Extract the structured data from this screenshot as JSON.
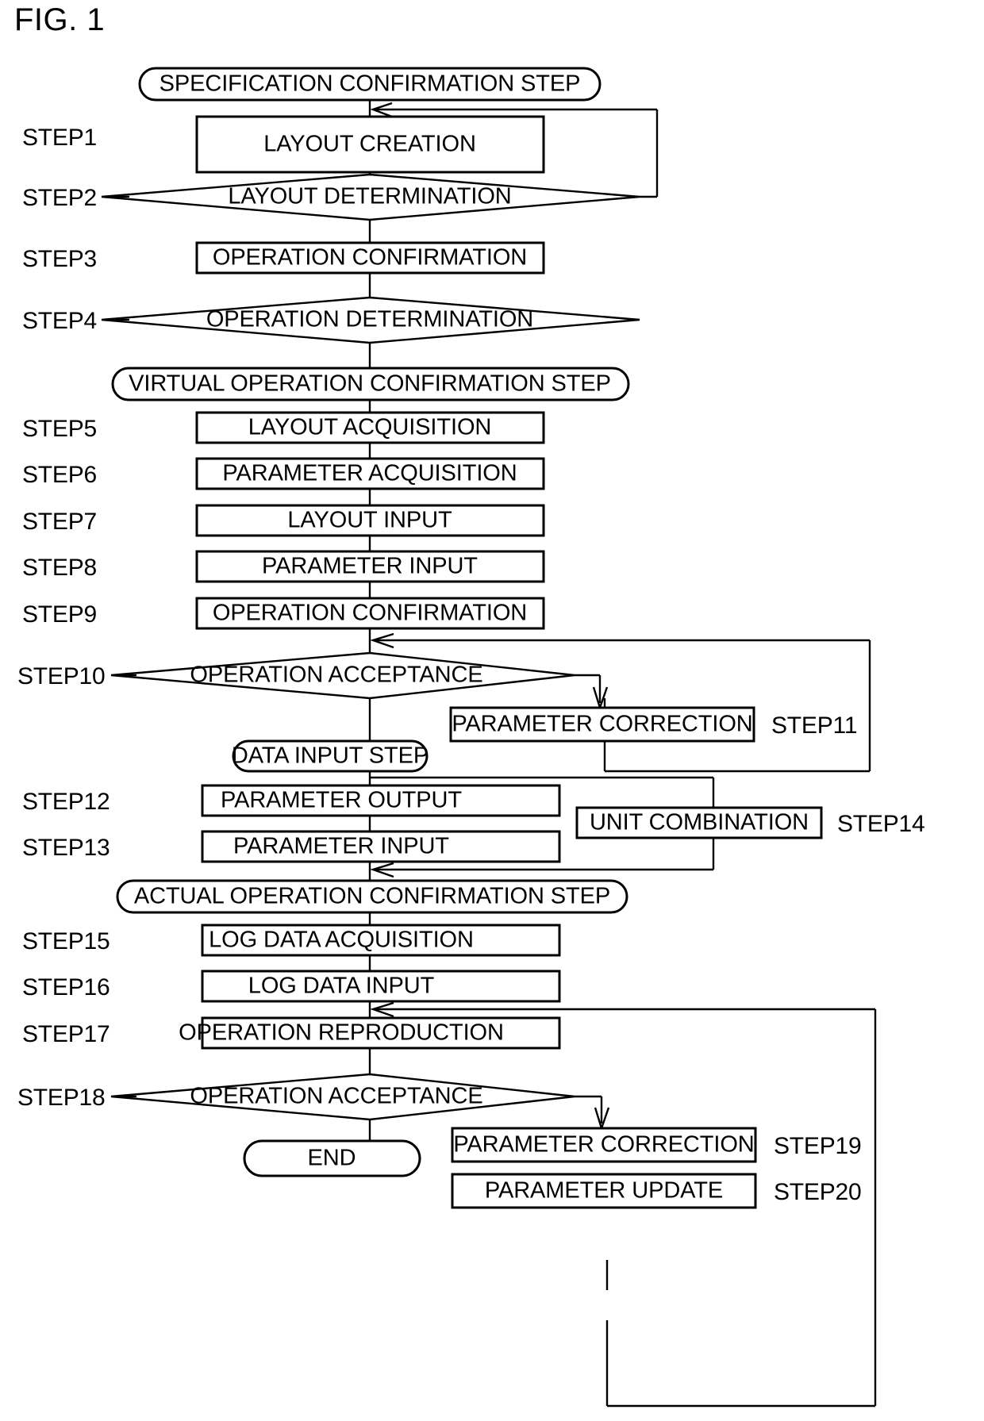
{
  "figure": {
    "caption": "FIG. 1"
  },
  "step_labels": [
    {
      "id": "step1",
      "text": "STEP1"
    },
    {
      "id": "step2",
      "text": "STEP2"
    },
    {
      "id": "step3",
      "text": "STEP3"
    },
    {
      "id": "step4",
      "text": "STEP4"
    },
    {
      "id": "step5",
      "text": "STEP5"
    },
    {
      "id": "step6",
      "text": "STEP6"
    },
    {
      "id": "step7",
      "text": "STEP7"
    },
    {
      "id": "step8",
      "text": "STEP8"
    },
    {
      "id": "step9",
      "text": "STEP9"
    },
    {
      "id": "step10",
      "text": "STEP10"
    },
    {
      "id": "step11",
      "text": "STEP11"
    },
    {
      "id": "step12",
      "text": "STEP12"
    },
    {
      "id": "step13",
      "text": "STEP13"
    },
    {
      "id": "step14",
      "text": "STEP14"
    },
    {
      "id": "step15",
      "text": "STEP15"
    },
    {
      "id": "step16",
      "text": "STEP16"
    },
    {
      "id": "step17",
      "text": "STEP17"
    },
    {
      "id": "step18",
      "text": "STEP18"
    },
    {
      "id": "step19",
      "text": "STEP19"
    },
    {
      "id": "step20",
      "text": "STEP20"
    }
  ],
  "nodes": {
    "spec_confirmation_step": {
      "text": "SPECIFICATION CONFIRMATION STEP",
      "shape": "stadium"
    },
    "layout_creation": {
      "text": "LAYOUT CREATION",
      "shape": "rect"
    },
    "layout_determination": {
      "text": "LAYOUT DETERMINATION",
      "shape": "diamond"
    },
    "operation_confirmation_1": {
      "text": "OPERATION CONFIRMATION",
      "shape": "rect"
    },
    "operation_determination": {
      "text": "OPERATION DETERMINATION",
      "shape": "diamond"
    },
    "virtual_operation_confirmation_step": {
      "text": "VIRTUAL OPERATION CONFIRMATION STEP",
      "shape": "stadium"
    },
    "layout_acquisition": {
      "text": "LAYOUT ACQUISITION",
      "shape": "rect"
    },
    "parameter_acquisition": {
      "text": "PARAMETER ACQUISITION",
      "shape": "rect"
    },
    "layout_input": {
      "text": "LAYOUT INPUT",
      "shape": "rect"
    },
    "parameter_input_1": {
      "text": "PARAMETER INPUT",
      "shape": "rect"
    },
    "operation_confirmation_2": {
      "text": "OPERATION CONFIRMATION",
      "shape": "rect"
    },
    "operation_acceptance_1": {
      "text": "OPERATION ACCEPTANCE",
      "shape": "diamond"
    },
    "parameter_correction_1": {
      "text": "PARAMETER CORRECTION",
      "shape": "rect"
    },
    "data_input_step": {
      "text": "DATA INPUT STEP",
      "shape": "stadium"
    },
    "parameter_output": {
      "text": "PARAMETER OUTPUT",
      "shape": "rect"
    },
    "unit_combination": {
      "text": "UNIT COMBINATION",
      "shape": "rect"
    },
    "parameter_input_2": {
      "text": "PARAMETER INPUT",
      "shape": "rect"
    },
    "actual_operation_confirmation_step": {
      "text": "ACTUAL OPERATION CONFIRMATION STEP",
      "shape": "stadium"
    },
    "log_data_acquisition": {
      "text": "LOG DATA ACQUISITION",
      "shape": "rect"
    },
    "log_data_input": {
      "text": "LOG DATA INPUT",
      "shape": "rect"
    },
    "operation_reproduction": {
      "text": "OPERATION REPRODUCTION",
      "shape": "rect"
    },
    "operation_acceptance_2": {
      "text": "OPERATION ACCEPTANCE",
      "shape": "diamond"
    },
    "end": {
      "text": "END",
      "shape": "stadium"
    },
    "parameter_correction_2": {
      "text": "PARAMETER CORRECTION",
      "shape": "rect"
    },
    "parameter_update": {
      "text": "PARAMETER UPDATE",
      "shape": "rect"
    }
  },
  "colors": {
    "ink": "#000000",
    "paper": "#ffffff"
  }
}
